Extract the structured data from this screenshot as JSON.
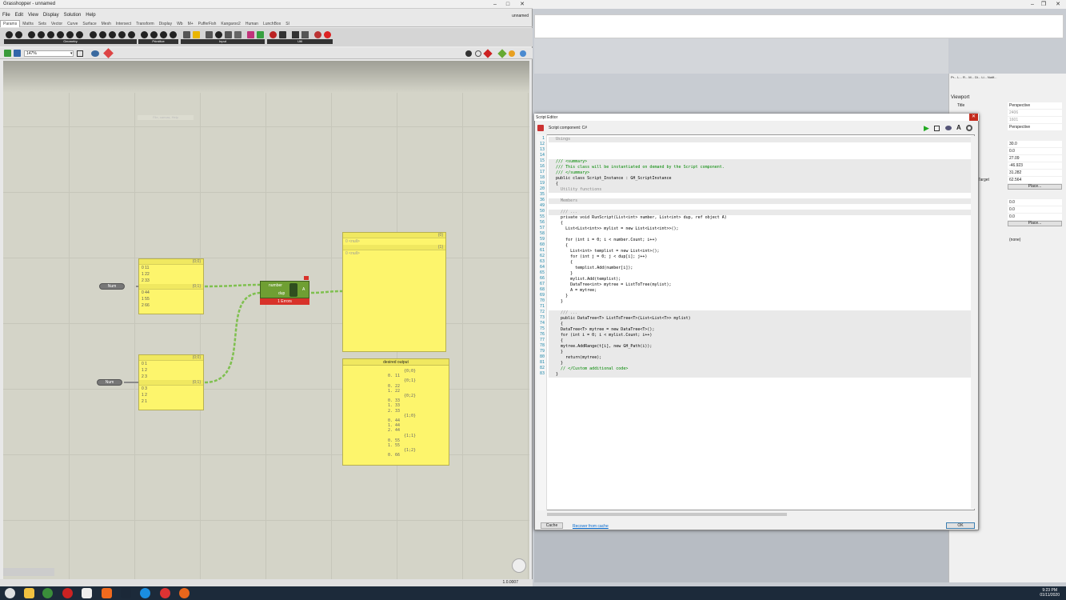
{
  "gh": {
    "title": "Grasshopper - unnamed",
    "doc_name": "unnamed",
    "menu": [
      "File",
      "Edit",
      "View",
      "Display",
      "Solution",
      "Help"
    ],
    "tabs": [
      "Params",
      "Maths",
      "Sets",
      "Vector",
      "Curve",
      "Surface",
      "Mesh",
      "Intersect",
      "Transform",
      "Display",
      "Wb",
      "M+",
      "PufferFish",
      "Kangaroo2",
      "Human",
      "LunchBox",
      "SI"
    ],
    "active_tab": "Params",
    "ribbon_sections": [
      "Geometry",
      "Primitive",
      "Input",
      "Util"
    ],
    "zoom": "147%",
    "canvas_hint": "File, canvas, Help",
    "version": "1.0.0007",
    "num_label": "Num",
    "panel1": {
      "h1": "{0;0}",
      "rows1": [
        "0  11",
        "1  22",
        "2  33"
      ],
      "h2": "{0;1}",
      "rows2": [
        "0  44",
        "1  55",
        "2  66"
      ]
    },
    "panel2": {
      "h1": "{0;0}",
      "rows1": [
        "0  1",
        "1  2",
        "2  3"
      ],
      "h2": "{0;1}",
      "rows2": [
        "0  3",
        "1  2",
        "2  1"
      ]
    },
    "script": {
      "in1": "number",
      "in2": "dup",
      "out": "A",
      "error": "1 Errors"
    },
    "output_panel": {
      "h1": "{0}",
      "r1": "0  <null>",
      "h2": "{1}",
      "r2": "0  <null>"
    },
    "desired": {
      "title": "desired output",
      "lines": [
        "{0;0}",
        "0. 11",
        "{0;1}",
        "0. 22",
        "1. 22",
        "{0;2}",
        "0. 33",
        "1. 33",
        "2. 33",
        "{1;0}",
        "0. 44",
        "1. 44",
        "2. 44",
        "{1;1}",
        "0. 55",
        "1. 55",
        "{1;2}",
        "0. 66"
      ]
    }
  },
  "rhino": {
    "props_tabs": [
      "Pr...",
      "L...",
      "R...",
      "M...",
      "Di...",
      "Li...",
      "Notif..."
    ],
    "viewport_label": "Viewport",
    "rows": [
      {
        "k": "Title",
        "v": "Perspective"
      },
      {
        "k": "",
        "v": "2406"
      },
      {
        "k": "",
        "v": "1601"
      },
      {
        "k": "",
        "v": "Perspective"
      },
      {
        "k": "",
        "v": "30.0"
      },
      {
        "k": "",
        "v": "0.0"
      },
      {
        "k": "",
        "v": "27.09"
      },
      {
        "k": "",
        "v": "-46.923"
      },
      {
        "k": "",
        "v": "31.282"
      },
      {
        "k": "Target",
        "v": "62.564"
      },
      {
        "k": "",
        "v": "0.0"
      },
      {
        "k": "",
        "v": "0.0"
      },
      {
        "k": "",
        "v": "0.0"
      },
      {
        "k": "",
        "v": "(none)"
      }
    ],
    "place_label": "Place..."
  },
  "editor": {
    "title": "Script Editor",
    "component": "Script component: C#",
    "cache_label": "Cache",
    "recover_label": "Recover from cache",
    "ok_label": "OK",
    "lines": [
      {
        "n": "1",
        "t": "   Usings",
        "g": true
      },
      {
        "n": "12",
        "t": ""
      },
      {
        "n": "13",
        "t": ""
      },
      {
        "n": "14",
        "t": ""
      },
      {
        "n": "15",
        "t": "   /// <summary>",
        "c": "cm"
      },
      {
        "n": "16",
        "t": "   /// This class will be instantiated on demand by the Script component.",
        "c": "cm"
      },
      {
        "n": "17",
        "t": "   /// </summary>",
        "c": "cm"
      },
      {
        "n": "18",
        "t": "   public class Script_Instance : GH_ScriptInstance"
      },
      {
        "n": "19",
        "t": "   {"
      },
      {
        "n": "20",
        "t": "     Utility functions",
        "g": true
      },
      {
        "n": "35",
        "t": ""
      },
      {
        "n": "36",
        "t": "     Members",
        "g": true
      },
      {
        "n": "49",
        "t": ""
      },
      {
        "n": "50",
        "t": "     /// ...",
        "g": true
      },
      {
        "n": "55",
        "t": "     private void RunScript(List<int> number, List<int> dup, ref object A)"
      },
      {
        "n": "56",
        "t": "     {"
      },
      {
        "n": "57",
        "t": "       List<List<int>> mylist = new List<List<int>>();"
      },
      {
        "n": "58",
        "t": ""
      },
      {
        "n": "59",
        "t": "       for (int i = 0; i < number.Count; i++)"
      },
      {
        "n": "60",
        "t": "       {"
      },
      {
        "n": "61",
        "t": "         List<int> templist = new List<int>();"
      },
      {
        "n": "62",
        "t": "         for (int j = 0; j < dup[i]; j++)"
      },
      {
        "n": "63",
        "t": "         {"
      },
      {
        "n": "64",
        "t": "           templist.Add(number[i]);"
      },
      {
        "n": "65",
        "t": "         }"
      },
      {
        "n": "66",
        "t": "         mylist.Add(templist);"
      },
      {
        "n": "67",
        "t": "         DataTree<int> mytree = ListToTree(mylist);"
      },
      {
        "n": "68",
        "t": "         A = mytree;"
      },
      {
        "n": "69",
        "t": "       }"
      },
      {
        "n": "70",
        "t": "     }"
      },
      {
        "n": "71",
        "t": ""
      },
      {
        "n": "72",
        "t": "     /// ...",
        "g": true
      },
      {
        "n": "73",
        "t": "     public DataTree<T> ListToTree<T>(List<List<T>> mylist)"
      },
      {
        "n": "74",
        "t": "     {"
      },
      {
        "n": "75",
        "t": "     DataTree<T> mytree = new DataTree<T>();"
      },
      {
        "n": "76",
        "t": "     for (int i = 0; i < mylist.Count; i++)"
      },
      {
        "n": "77",
        "t": "     {"
      },
      {
        "n": "78",
        "t": "     mytree.AddRange(t[i], new GH_Path(i));"
      },
      {
        "n": "79",
        "t": "     }"
      },
      {
        "n": "80",
        "t": "       return(mytree);"
      },
      {
        "n": "81",
        "t": "     }"
      },
      {
        "n": "82",
        "t": "     // </Custom additional code>",
        "c": "cm"
      },
      {
        "n": "83",
        "t": "   }"
      }
    ]
  },
  "clock": {
    "time": "9:23 PM",
    "date": "01/11/2020"
  }
}
